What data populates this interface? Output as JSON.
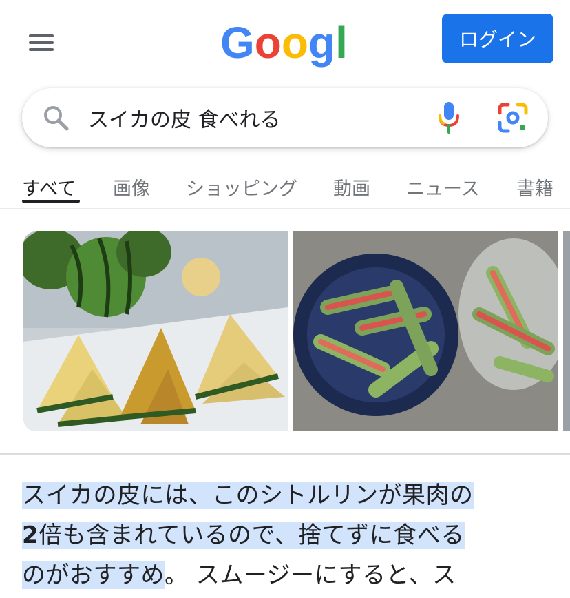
{
  "header": {
    "logo_text": "Google",
    "login_label": "ログイン"
  },
  "search": {
    "query": "スイカの皮 食べれる"
  },
  "tabs": [
    {
      "label": "すべて",
      "active": true
    },
    {
      "label": "画像"
    },
    {
      "label": "ショッピング"
    },
    {
      "label": "動画"
    },
    {
      "label": "ニュース"
    },
    {
      "label": "書籍"
    }
  ],
  "snippet": {
    "line1_highlight": "スイカの皮には、このシトルリンが果肉の",
    "line2_bold": "2",
    "line2_highlight": "倍も含まれているので、捨てずに食べる",
    "line3_highlight": "のがおすすめ",
    "line3_rest": "。 スムージーにすると、ス"
  },
  "colors": {
    "accent": "#1a73e8",
    "highlight": "#d2e3fc",
    "google_blue": "#4285F4",
    "google_red": "#EA4335",
    "google_yellow": "#FBBC05",
    "google_green": "#34A853"
  },
  "icons": [
    "menu-icon",
    "search-icon",
    "mic-icon",
    "lens-icon"
  ]
}
